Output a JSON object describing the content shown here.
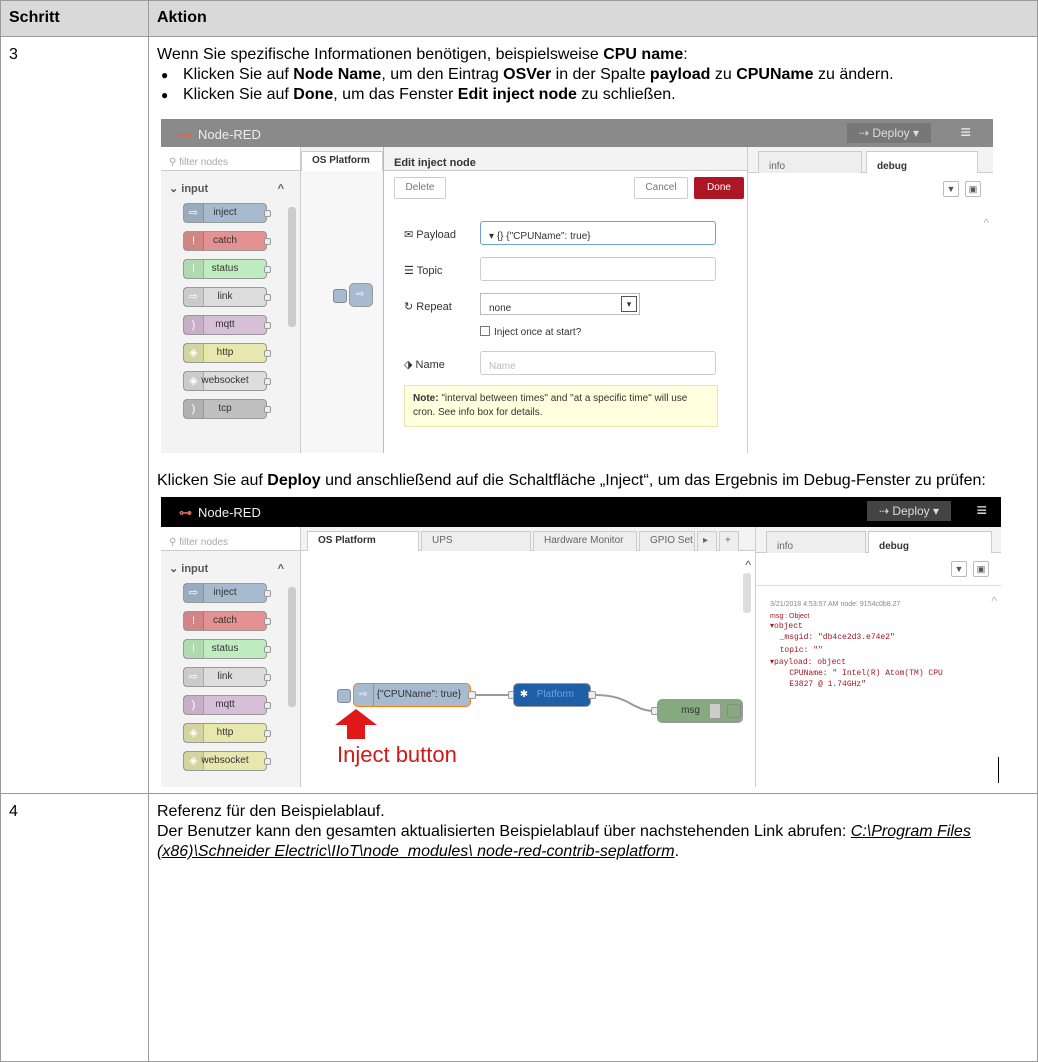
{
  "table": {
    "col_step": "Schritt",
    "col_action": "Aktion"
  },
  "row3": {
    "step": "3",
    "intro_before": "Wenn Sie spezifische Informationen benötigen, beispielsweise ",
    "intro_bold": "CPU name",
    "intro_after": ":",
    "bullet1": {
      "t1": "Klicken Sie auf ",
      "b1": "Node Name",
      "t2": ", um den Eintrag ",
      "b2": "OSVer",
      "t3": " in der Spalte ",
      "b3": "payload",
      "t4": " zu ",
      "b4": "CPUName",
      "t5": " zu ändern."
    },
    "bullet2": {
      "t1": "Klicken Sie auf ",
      "b1": "Done",
      "t2": ", um das Fenster ",
      "b2": "Edit inject node",
      "t3": " zu schließen."
    },
    "deploy_text": {
      "t1": "Klicken Sie auf ",
      "b1": "Deploy",
      "t2": " und anschließend auf die Schaltfläche „Inject“, um das Ergebnis im Debug-Fenster zu prüfen:"
    }
  },
  "row4": {
    "step": "4",
    "line1": "Referenz für den Beispielablauf.",
    "line2": "Der Benutzer kann den gesamten aktualisierten Beispielablauf über nachstehenden Link abrufen: ",
    "link": "C:\\Program Files (x86)\\Schneider Electric\\IIoT\\node_modules\\ node-red-contrib-seplatform",
    "after_link": "."
  },
  "screenshot1": {
    "app_name": "Node-RED",
    "deploy": "Deploy",
    "filter_placeholder": "filter nodes",
    "category": "input",
    "palette_nodes": [
      "inject",
      "catch",
      "status",
      "link",
      "mqtt",
      "http",
      "websocket",
      "tcp"
    ],
    "flow_tab": "OS Platform",
    "dialog_title": "Edit inject node",
    "delete_btn": "Delete",
    "cancel_btn": "Cancel",
    "done_btn": "Done",
    "payload_label": "Payload",
    "payload_type": "{}",
    "payload_value": "{\"CPUName\": true}",
    "topic_label": "Topic",
    "repeat_label": "Repeat",
    "repeat_value": "none",
    "inject_once": "Inject once at start?",
    "name_label": "Name",
    "name_placeholder": "Name",
    "note_bold": "Note:",
    "note_text": " \"interval between times\" and \"at a specific time\" will use cron. See info box for details.",
    "sidebar_tab_info": "info",
    "sidebar_tab_debug": "debug"
  },
  "screenshot2": {
    "app_name": "Node-RED",
    "deploy": "Deploy",
    "filter_placeholder": "filter nodes",
    "category": "input",
    "palette_nodes": [
      "inject",
      "catch",
      "status",
      "link",
      "mqtt",
      "http",
      "websocket"
    ],
    "tabs": [
      "OS Platform",
      "UPS",
      "Hardware Monitor",
      "GPIO Set"
    ],
    "sidebar_tab_info": "info",
    "sidebar_tab_debug": "debug",
    "debug_meta": "3/21/2018 4:53:57 AM  node: 9154c0b8.27",
    "debug_msg": "msg : Object",
    "debug_lines": [
      "▾object",
      "  _msgid: \"db4ce2d3.e74e2\"",
      "  topic: \"\"",
      "▾payload: object",
      "    CPUName: \" Intel(R) Atom(TM) CPU",
      "    E3827 @ 1.74GHz\""
    ],
    "flow_inject": "{\"CPUName\": true}",
    "flow_platform": "Platform",
    "flow_debug": "msg",
    "annotation": "Inject button"
  }
}
